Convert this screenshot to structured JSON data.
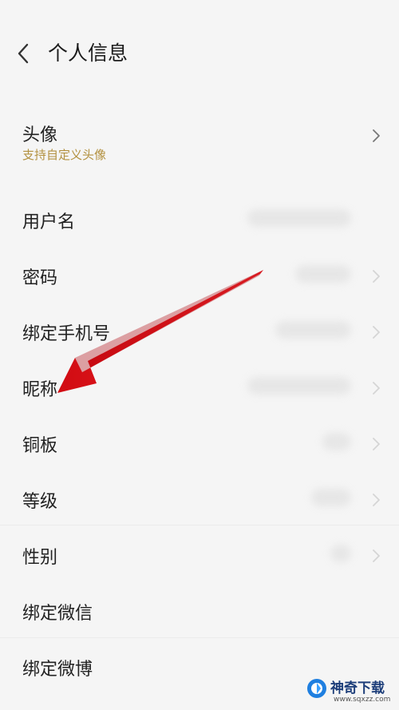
{
  "header": {
    "title": "个人信息",
    "back_icon": "chevron-left-icon"
  },
  "avatar_row": {
    "label": "头像",
    "subtitle": "支持自定义头像"
  },
  "rows": {
    "username": {
      "label": "用户名"
    },
    "password": {
      "label": "密码"
    },
    "phone": {
      "label": "绑定手机号"
    },
    "nickname": {
      "label": "昵称"
    },
    "coins": {
      "label": "铜板"
    },
    "level": {
      "label": "等级"
    },
    "gender": {
      "label": "性别"
    },
    "wechat": {
      "label": "绑定微信"
    },
    "weibo": {
      "label": "绑定微博"
    }
  },
  "annotation": {
    "arrow_color": "#e3131b",
    "points_to": "昵称"
  },
  "watermark": {
    "name": "神奇下载",
    "url": "www.sqxzz.com"
  },
  "colors": {
    "background": "#f5f5f5",
    "subtitle_gold": "#b39140",
    "text": "#222222"
  }
}
